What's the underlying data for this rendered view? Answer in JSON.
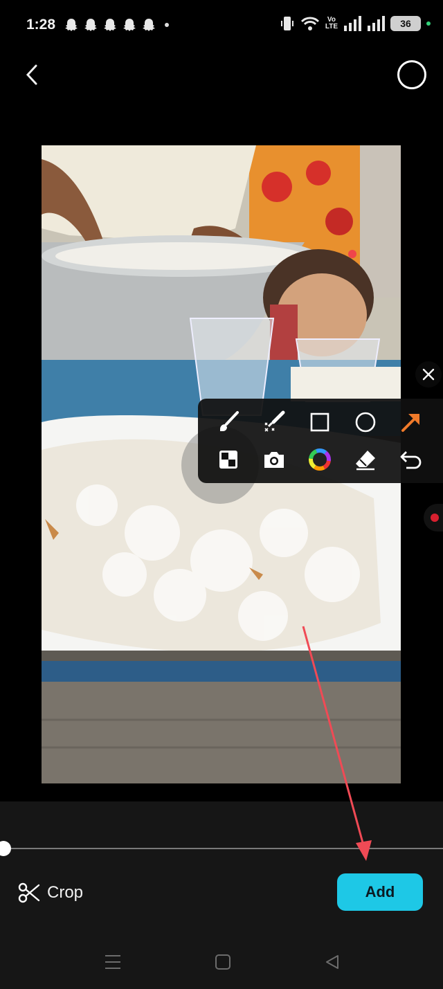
{
  "status": {
    "time": "1:28",
    "notification_icons": [
      "snapchat-icon",
      "snapchat-icon",
      "snapchat-icon",
      "snapchat-icon",
      "snapchat-icon"
    ],
    "network_label": "Vo\nLTE",
    "battery": "36"
  },
  "toolbar": {
    "tools": [
      {
        "name": "brush-tool",
        "icon": "brush-icon"
      },
      {
        "name": "highlighter-tool",
        "icon": "sparkle-brush-icon"
      },
      {
        "name": "rectangle-tool",
        "icon": "square-icon"
      },
      {
        "name": "circle-tool",
        "icon": "circle-icon"
      },
      {
        "name": "arrow-tool",
        "icon": "arrow-icon"
      },
      {
        "name": "mosaic-tool",
        "icon": "mosaic-icon"
      },
      {
        "name": "screenshot-tool",
        "icon": "camera-icon"
      },
      {
        "name": "color-picker-tool",
        "icon": "color-wheel-icon"
      },
      {
        "name": "eraser-tool",
        "icon": "eraser-icon"
      },
      {
        "name": "undo-tool",
        "icon": "undo-icon"
      }
    ],
    "arrow_color": "#f07a2a"
  },
  "editor": {
    "crop_label": "Crop",
    "add_label": "Add",
    "accent_color": "#1ec8e6"
  }
}
